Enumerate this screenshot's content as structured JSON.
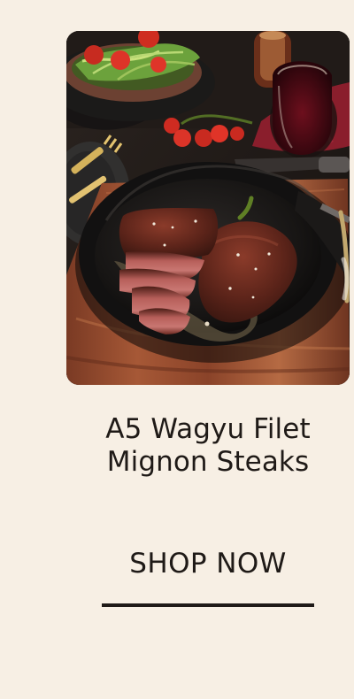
{
  "product": {
    "image_alt": "A5 Wagyu Filet Mignon Steaks in a cast iron skillet",
    "title": "A5 Wagyu Filet Mignon Steaks"
  },
  "cta": {
    "label": "SHOP NOW"
  },
  "colors": {
    "background": "#f7efe4",
    "text": "#1f1a17",
    "underline": "#1f1a17"
  }
}
